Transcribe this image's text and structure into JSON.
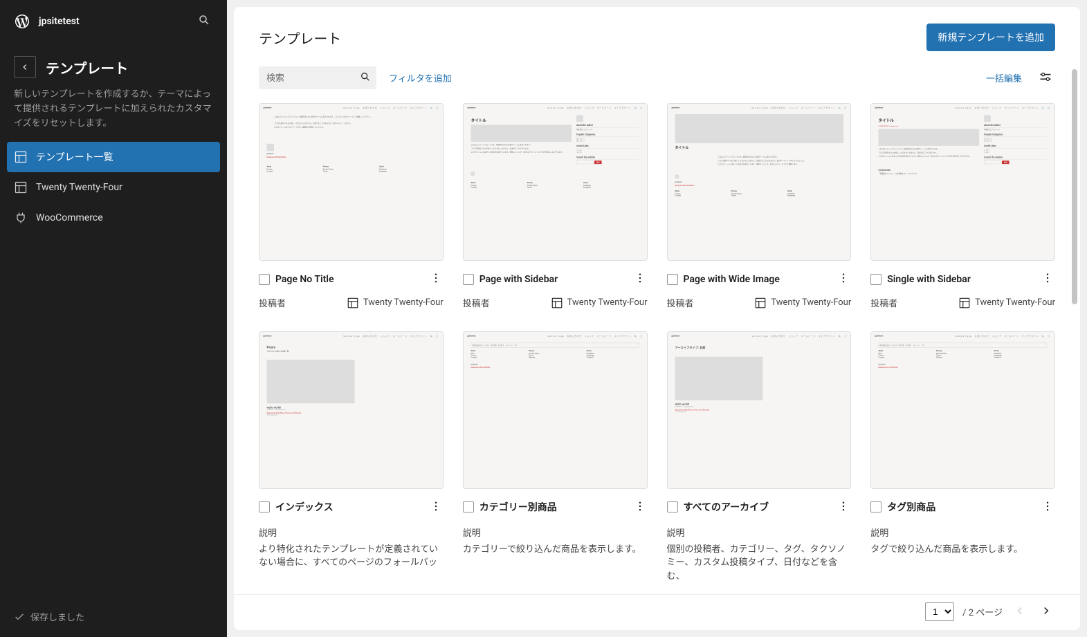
{
  "site_name": "jpsitetest",
  "sidebar": {
    "title": "テンプレート",
    "description": "新しいテンプレートを作成するか、テーマによって提供されるテンプレートに加えられたカスタマイズをリセットします。",
    "items": [
      {
        "label": "テンプレート一覧",
        "icon": "layout-icon",
        "active": true
      },
      {
        "label": "Twenty Twenty-Four",
        "icon": "layout-icon",
        "active": false
      },
      {
        "label": "WooCommerce",
        "icon": "plugin-icon",
        "active": false
      }
    ],
    "footer": "保存しました"
  },
  "header": {
    "title": "テンプレート",
    "new_button": "新規テンプレートを追加"
  },
  "toolbar": {
    "search_placeholder": "検索",
    "add_filter": "フィルタを追加",
    "bulk_edit": "一括編集"
  },
  "meta_labels": {
    "author": "投稿者",
    "description": "説明"
  },
  "theme_name": "Twenty Twenty-Four",
  "templates": [
    {
      "title": "Page No Title",
      "meta_type": "author",
      "desc": ""
    },
    {
      "title": "Page with Sidebar",
      "meta_type": "author",
      "desc": ""
    },
    {
      "title": "Page with Wide Image",
      "meta_type": "author",
      "desc": ""
    },
    {
      "title": "Single with Sidebar",
      "meta_type": "author",
      "desc": ""
    },
    {
      "title": "インデックス",
      "meta_type": "description",
      "desc": "より特化されたテンプレートが定義されていない場合に、すべてのページのフォールバッ"
    },
    {
      "title": "カテゴリー別商品",
      "meta_type": "description",
      "desc": "カテゴリーで絞り込んだ商品を表示します。"
    },
    {
      "title": "すべてのアーカイブ",
      "meta_type": "description",
      "desc": "個別の投稿者、カテゴリー、タグ、タクソノミー、カスタム投稿タイプ、日付などを含む、"
    },
    {
      "title": "タグ別商品",
      "meta_type": "description",
      "desc": "タグで絞り込んだ商品を表示します。"
    }
  ],
  "pagination": {
    "current": "1",
    "total_label": "/ 2 ページ"
  }
}
